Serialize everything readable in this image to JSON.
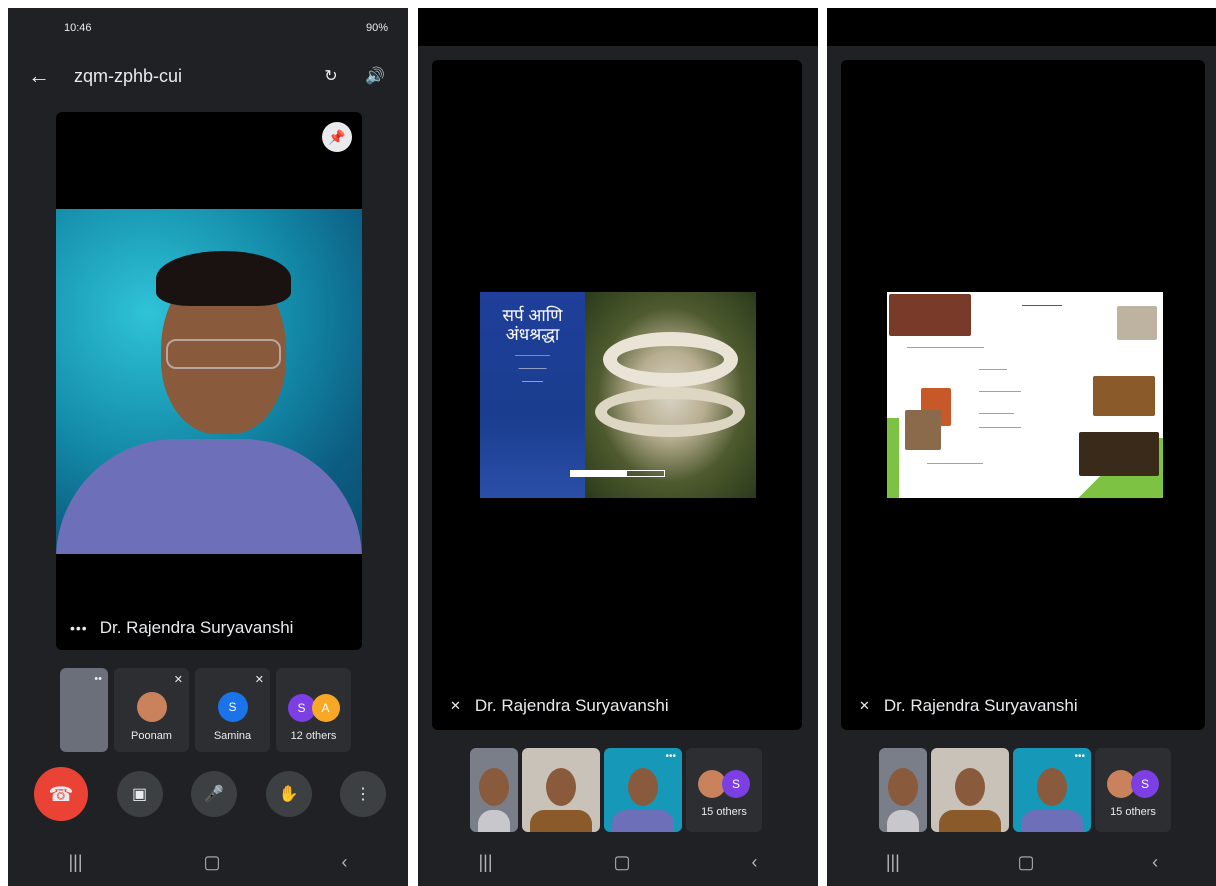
{
  "screen1": {
    "status": {
      "time": "10:46",
      "right": "90%"
    },
    "topbar": {
      "meeting_code": "zqm-zphb-cui"
    },
    "main_tile": {
      "name": "Dr. Rajendra Suryavanshi"
    },
    "participants": [
      {
        "name": "Poonam"
      },
      {
        "name": "Samina",
        "initial": "S"
      },
      {
        "name": "12 others",
        "initials": [
          "S",
          "A"
        ]
      }
    ]
  },
  "screen2": {
    "presenter": "Dr. Rajendra Suryavanshi",
    "slide": {
      "title": "सर्प आणि अंधश्रद्धा"
    },
    "others": "15 others",
    "others_initial": "S"
  },
  "screen3": {
    "presenter": "Dr. Rajendra Suryavanshi",
    "others": "15 others",
    "others_initial": "S"
  },
  "colors": {
    "background": "#202124",
    "end_call": "#ea4335",
    "avatar_blue": "#1a73e8",
    "avatar_purple": "#7b3fe4",
    "avatar_orange": "#f9a825"
  }
}
